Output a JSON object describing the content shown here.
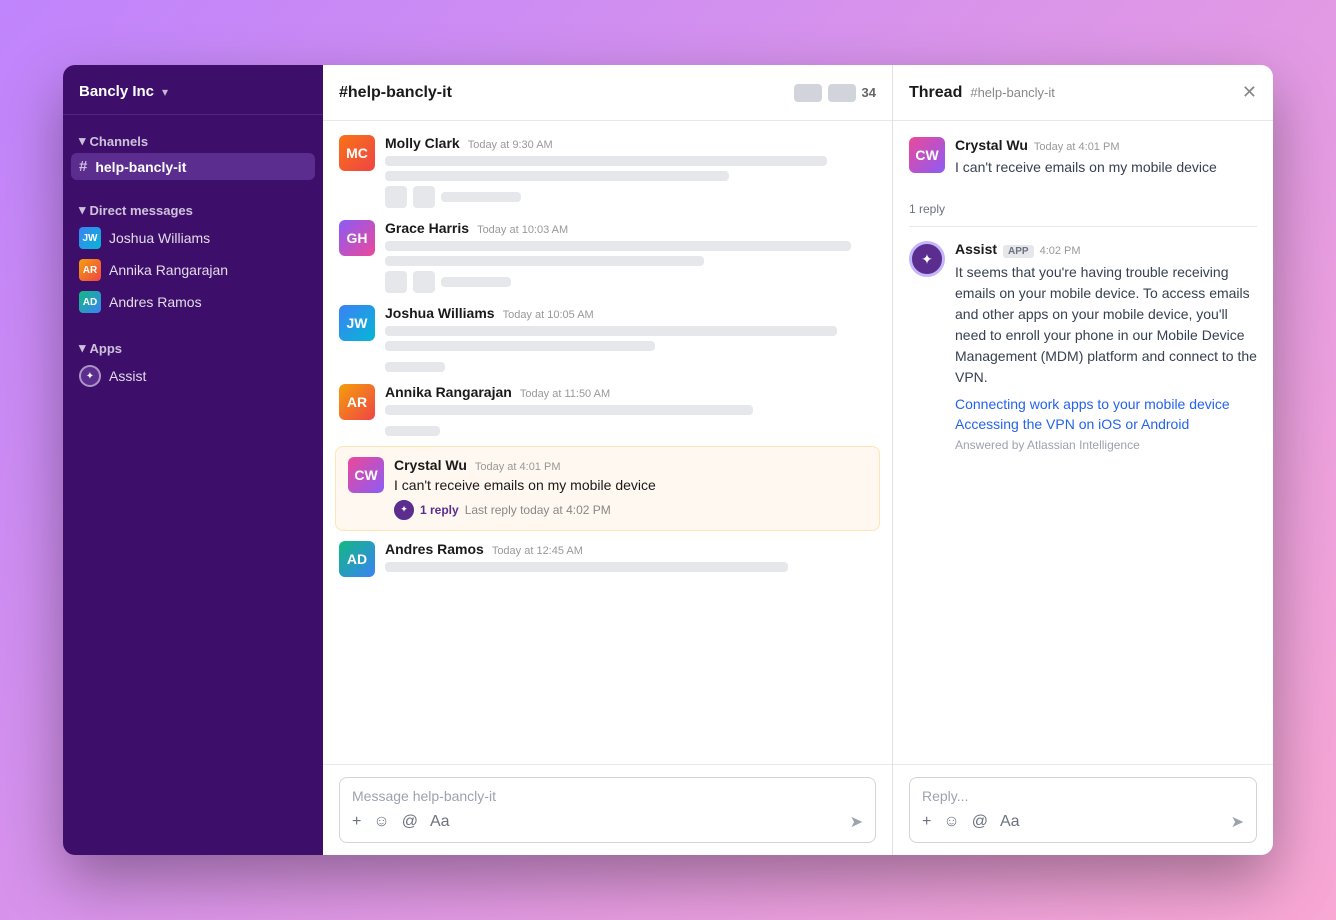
{
  "sidebar": {
    "workspace": "Bancly Inc",
    "channels_label": "Channels",
    "active_channel": "#  help-bancly-it",
    "direct_messages_label": "Direct messages",
    "direct_messages": [
      {
        "name": "Joshua Williams",
        "initials": "JW"
      },
      {
        "name": "Annika Rangarajan",
        "initials": "AR"
      },
      {
        "name": "Andres Ramos",
        "initials": "AD"
      }
    ],
    "apps_label": "Apps",
    "app_name": "Assist"
  },
  "chat": {
    "channel_name": "#help-bancly-it",
    "member_count": "34",
    "messages": [
      {
        "name": "Molly Clark",
        "time": "Today at 9:30 AM",
        "initials": "MC",
        "av_class": "av-molly"
      },
      {
        "name": "Grace Harris",
        "time": "Today at 10:03 AM",
        "initials": "GH",
        "av_class": "av-grace"
      },
      {
        "name": "Joshua Williams",
        "time": "Today at 10:05 AM",
        "initials": "JW",
        "av_class": "av-joshua"
      },
      {
        "name": "Annika Rangarajan",
        "time": "Today at 11:50 AM",
        "initials": "AR",
        "av_class": "av-annika"
      }
    ],
    "highlighted_message": {
      "name": "Crystal Wu",
      "time": "Today at 4:01 PM",
      "initials": "CW",
      "av_class": "av-crystal",
      "text": "I can't receive emails on my mobile device",
      "reply_count": "1 reply",
      "reply_time": "Last reply today at 4:02 PM"
    },
    "andres_message": {
      "name": "Andres Ramos",
      "time": "Today at 12:45 AM",
      "initials": "AD",
      "av_class": "av-andres"
    },
    "input_placeholder": "Message help-bancly-it",
    "toolbar": {
      "plus": "+",
      "emoji": "☺",
      "at": "@",
      "format": "Aa"
    }
  },
  "thread": {
    "title": "Thread",
    "channel_ref": "#help-bancly-it",
    "close_label": "✕",
    "crystal_message": {
      "name": "Crystal Wu",
      "time": "Today at 4:01 PM",
      "initials": "CW",
      "av_class": "av-crystal",
      "text": "I can't receive emails on my mobile device"
    },
    "reply_count": "1 reply",
    "assist_message": {
      "name": "Assist",
      "app_badge": "APP",
      "time": "4:02 PM",
      "text": "It seems that you're having trouble receiving emails on your mobile device. To access emails and other apps on your mobile device, you'll need to enroll your phone in our Mobile Device Management (MDM) platform and connect to the VPN.",
      "links": [
        "Connecting work apps to your mobile device",
        "Accessing the VPN on iOS or Android"
      ],
      "answered_by": "Answered by Atlassian Intelligence"
    },
    "input_placeholder": "Reply...",
    "toolbar": {
      "plus": "+",
      "emoji": "☺",
      "at": "@",
      "format": "Aa"
    }
  }
}
